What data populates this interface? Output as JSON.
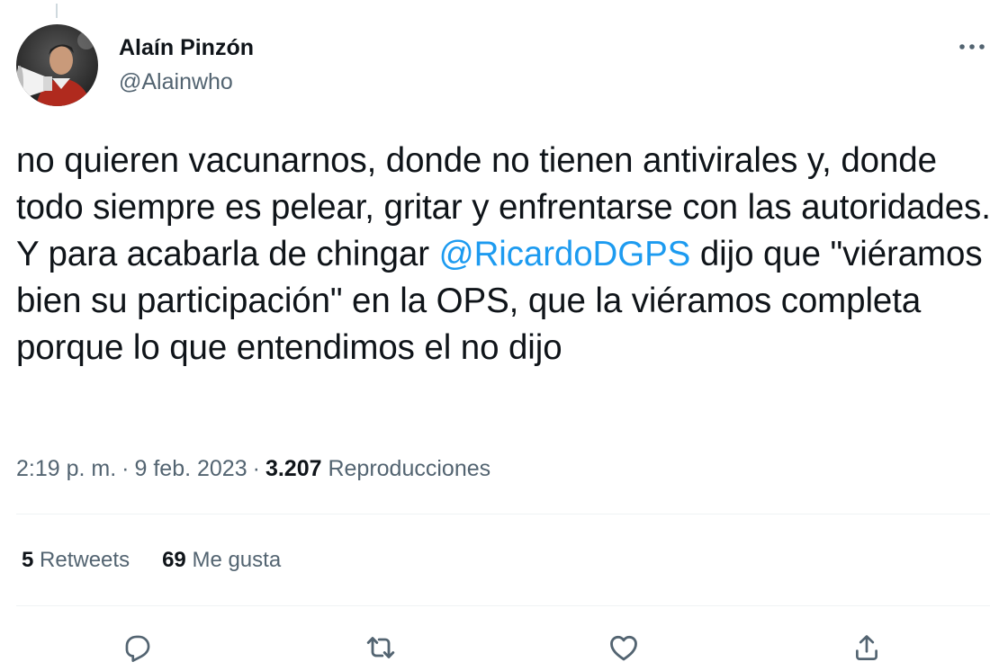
{
  "author": {
    "name": "Alaín Pinzón",
    "handle": "@Alainwho"
  },
  "tweet": {
    "text_before": "no quieren vacunarnos, donde no tienen antivirales y, donde todo siempre es pelear, gritar y enfrentarse con las autoridades. Y para acabarla de chingar ",
    "mention": "@RicardoDGPS",
    "text_after": " dijo que \"viéramos bien su participación\" en la OPS, que la viéramos completa porque lo que entendimos el no dijo"
  },
  "meta": {
    "time": "2:19 p. m.",
    "separator": "·",
    "date": "9 feb. 2023",
    "views_count": "3.207",
    "views_label": "Reproducciones"
  },
  "stats": {
    "retweets_count": "5",
    "retweets_label": "Retweets",
    "likes_count": "69",
    "likes_label": "Me gusta"
  },
  "icons": {
    "more": "more-horizontal-icon",
    "reply": "reply-icon",
    "retweet": "retweet-icon",
    "like": "heart-icon",
    "share": "share-icon"
  },
  "colors": {
    "mention": "#1d9bf0",
    "secondary_text": "#536471",
    "primary_text": "#0f1419"
  }
}
